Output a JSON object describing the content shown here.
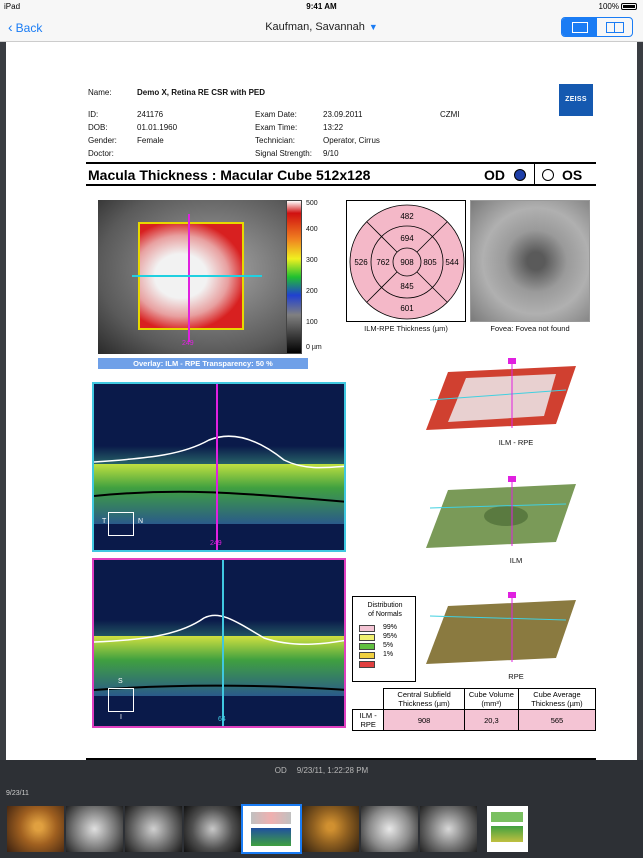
{
  "status_bar": {
    "device": "iPad",
    "time": "9:41 AM",
    "battery": "100%"
  },
  "nav": {
    "back_label": "Back",
    "patient_name": "Kaufman, Savannah"
  },
  "report": {
    "header": {
      "name_label": "Name:",
      "name_value": "Demo X, Retina RE CSR with PED",
      "id_label": "ID:",
      "id_value": "241176",
      "dob_label": "DOB:",
      "dob_value": "01.01.1960",
      "gender_label": "Gender:",
      "gender_value": "Female",
      "doctor_label": "Doctor:",
      "exam_date_label": "Exam Date:",
      "exam_date_value": "23.09.2011",
      "exam_time_label": "Exam Time:",
      "exam_time_value": "13:22",
      "technician_label": "Technician:",
      "technician_value": "Operator, Cirrus",
      "signal_label": "Signal Strength:",
      "signal_value": "9/10",
      "site": "CZMI",
      "logo_text": "ZEISS"
    },
    "title": "Macula Thickness : Macular Cube 512x128",
    "eye_od": "OD",
    "eye_os": "OS",
    "scale_ticks": [
      "500",
      "400",
      "300",
      "200",
      "100",
      "0 µm"
    ],
    "fundus_marker": "249",
    "overlay_label": "Overlay: ILM - RPE  Transparency: 50 %",
    "etdrs": {
      "superior_outer": "482",
      "superior_inner": "694",
      "nasal_outer": "526",
      "nasal_inner": "762",
      "center": "908",
      "temporal_inner": "805",
      "temporal_outer": "544",
      "inferior_inner": "845",
      "inferior_outer": "601",
      "caption": "ILM-RPE Thickness (µm)"
    },
    "fovea_caption": "Fovea: Fovea not found",
    "oct1": {
      "marker": "249",
      "t_label": "T",
      "n_label": "N"
    },
    "oct2": {
      "marker": "64",
      "s_label": "S",
      "i_label": "I"
    },
    "surfaces": {
      "ilm_rpe": "ILM - RPE",
      "ilm": "ILM",
      "rpe": "RPE"
    },
    "legend": {
      "title_line1": "Distribution",
      "title_line2": "of Normals",
      "p99": "99%",
      "p95": "95%",
      "p5": "5%",
      "p1": "1%"
    },
    "table": {
      "col1": "Central Subfield Thickness (µm)",
      "col2": "Cube Volume (mm³)",
      "col3": "Cube Average Thickness (µm)",
      "row_label": "ILM - RPE",
      "v1": "908",
      "v2": "20,3",
      "v3": "565"
    }
  },
  "footer": {
    "eye": "OD",
    "timestamp": "9/23/11, 1:22:28 PM",
    "date_label": "9/23/11"
  },
  "thumbnails": [
    {
      "kind": "color-fundus"
    },
    {
      "kind": "gray-fundus"
    },
    {
      "kind": "gray-fundus"
    },
    {
      "kind": "angiogram"
    },
    {
      "kind": "report",
      "selected": true
    },
    {
      "kind": "color-fundus"
    },
    {
      "kind": "gray-fundus"
    },
    {
      "kind": "gray-fundus"
    },
    {
      "kind": "report"
    }
  ]
}
